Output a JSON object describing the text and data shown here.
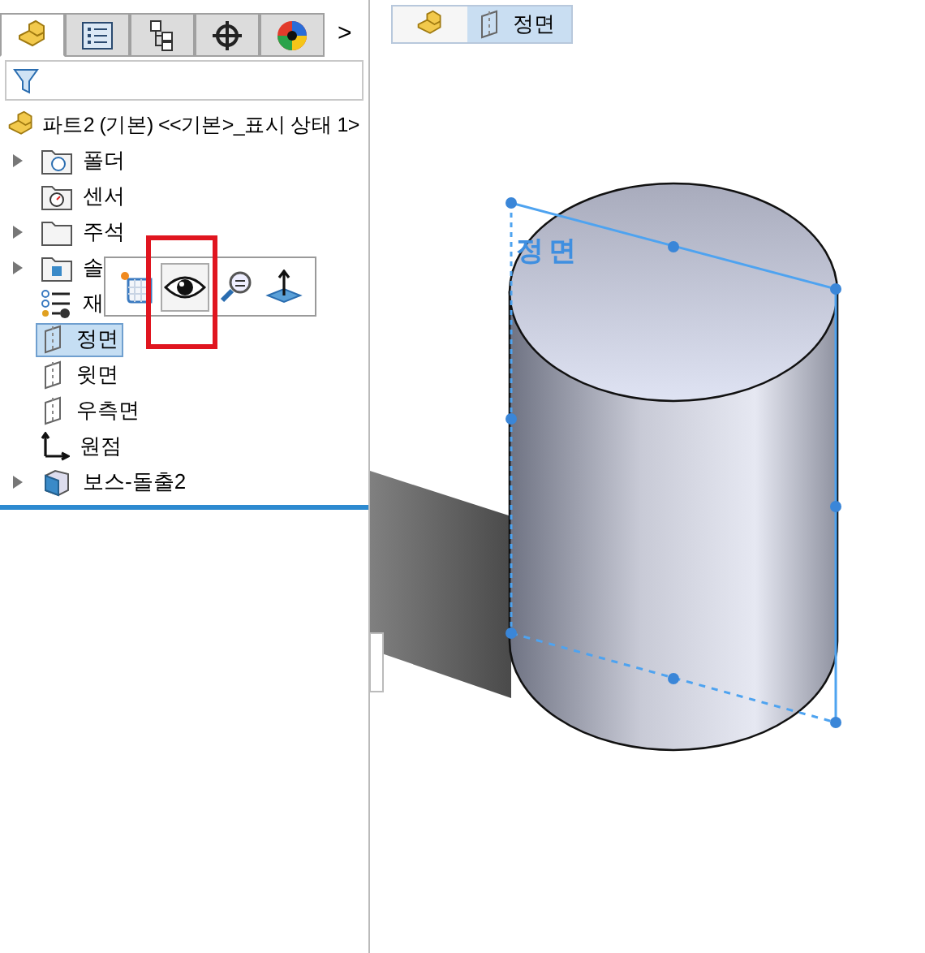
{
  "panel_tabs": [
    {
      "kind": "part",
      "selected": true
    },
    {
      "kind": "property",
      "selected": false
    },
    {
      "kind": "config",
      "selected": false
    },
    {
      "kind": "target",
      "selected": false
    },
    {
      "kind": "appearance",
      "selected": false
    }
  ],
  "tabs_more": ">",
  "tree": {
    "root": "파트2 (기본) <<기본>_표시 상태 1>",
    "items": [
      {
        "kind": "folder",
        "label": "폴더",
        "expanded": false,
        "selected": false
      },
      {
        "kind": "sensor",
        "label": "센서",
        "selected": false
      },
      {
        "kind": "note",
        "label": "주석",
        "expanded": false,
        "selected": false
      },
      {
        "kind": "body",
        "label": "솔",
        "expanded": false,
        "selected": false
      },
      {
        "kind": "material",
        "label": "재",
        "selected": false
      },
      {
        "kind": "plane",
        "label": "정면",
        "selected": true
      },
      {
        "kind": "plane",
        "label": "윗면",
        "selected": false
      },
      {
        "kind": "plane",
        "label": "우측면",
        "selected": false
      },
      {
        "kind": "origin",
        "label": "원점",
        "selected": false
      },
      {
        "kind": "extrude",
        "label": "보스-돌출2",
        "expanded": false,
        "selected": false
      }
    ]
  },
  "context_toolbar": [
    {
      "kind": "sketch",
      "selected": false
    },
    {
      "kind": "eye",
      "selected": true
    },
    {
      "kind": "zoom",
      "selected": false
    },
    {
      "kind": "normal",
      "selected": false
    }
  ],
  "breadcrumb": {
    "item": "정면"
  },
  "viewport": {
    "plane_label": "정면"
  }
}
